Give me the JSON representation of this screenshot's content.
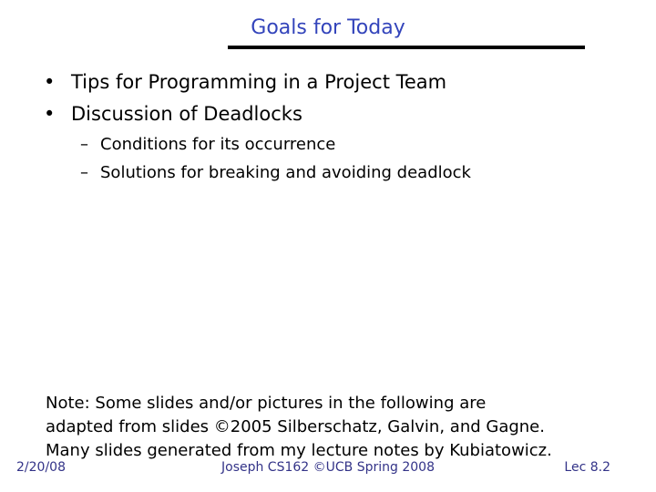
{
  "slide": {
    "title": "Goals for Today",
    "bullets": [
      {
        "marker": "•",
        "text": "Tips for Programming in a Project Team"
      },
      {
        "marker": "•",
        "text": "Discussion of Deadlocks",
        "subitems": [
          {
            "marker": "–",
            "text": "Conditions for its occurrence"
          },
          {
            "marker": "–",
            "text": "Solutions for breaking and avoiding deadlock"
          }
        ]
      }
    ],
    "note_lines": [
      "Note: Some slides and/or pictures in the following are",
      "adapted from slides ©2005 Silberschatz, Galvin, and Gagne.",
      "Many slides generated from my lecture notes by Kubiatowicz."
    ]
  },
  "footer": {
    "date": "2/20/08",
    "center": "Joseph CS162 ©UCB Spring 2008",
    "lecture": "Lec 8.2"
  },
  "colors": {
    "title": "#3344bb",
    "footer": "#333388",
    "text": "#000000"
  }
}
